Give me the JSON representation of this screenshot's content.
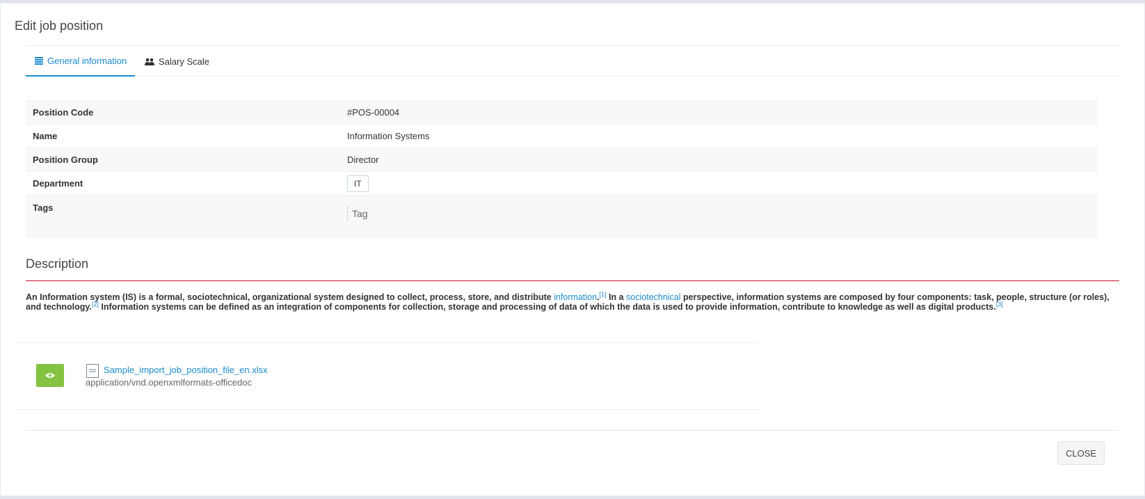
{
  "modal": {
    "title": "Edit job position"
  },
  "tabs": [
    {
      "label": "General information",
      "icon": "list-icon",
      "active": true
    },
    {
      "label": "Salary Scale",
      "icon": "users-icon",
      "active": false
    }
  ],
  "info": {
    "position_code": {
      "label": "Position Code",
      "value": "#POS-00004"
    },
    "name": {
      "label": "Name",
      "value": "Information Systems"
    },
    "position_group": {
      "label": "Position Group",
      "value": "Director"
    },
    "department": {
      "label": "Department",
      "value": "IT"
    },
    "tags": {
      "label": "Tags",
      "placeholder": "Tag"
    }
  },
  "description": {
    "title": "Description",
    "part1": "An Information system (IS) is a formal, sociotechnical, organizational system designed to collect, process, store, and distribute ",
    "link1": "information",
    "ref1": "[1]",
    "part2": " In a ",
    "link2": "sociotechnical",
    "part3": " perspective, information systems are composed by four components: task, people, structure (or roles), and technology.",
    "ref2": "[2]",
    "part4": " Information systems can be defined as an integration of components for collection, storage and processing of data of which the data is used to provide information, contribute to knowledge as well as digital products.",
    "ref3": "[3]"
  },
  "attachment": {
    "view_icon": "eye-icon",
    "file_icon": "document-icon",
    "filename": "Sample_import_job_position_file_en.xlsx",
    "mime": "application/vnd.openxmlformats-officedoc"
  },
  "footer": {
    "close_label": "CLOSE"
  },
  "colors": {
    "accent": "#1c8acb",
    "view_button": "#84c341",
    "description_rule": "#c8102e"
  }
}
